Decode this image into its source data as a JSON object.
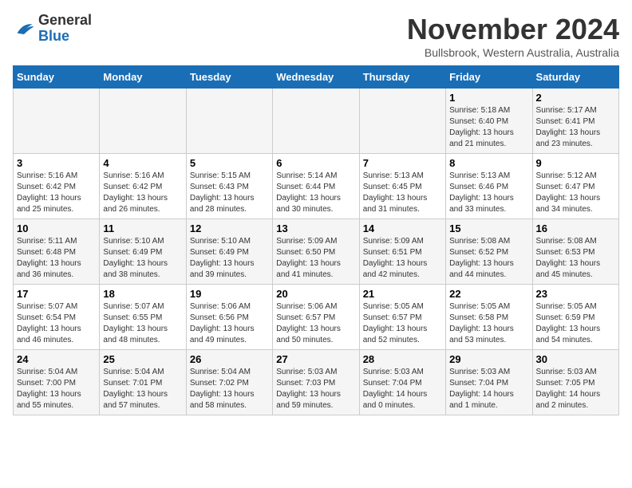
{
  "header": {
    "logo_general": "General",
    "logo_blue": "Blue",
    "month_title": "November 2024",
    "location": "Bullsbrook, Western Australia, Australia"
  },
  "days_of_week": [
    "Sunday",
    "Monday",
    "Tuesday",
    "Wednesday",
    "Thursday",
    "Friday",
    "Saturday"
  ],
  "weeks": [
    [
      {
        "day": "",
        "info": ""
      },
      {
        "day": "",
        "info": ""
      },
      {
        "day": "",
        "info": ""
      },
      {
        "day": "",
        "info": ""
      },
      {
        "day": "",
        "info": ""
      },
      {
        "day": "1",
        "info": "Sunrise: 5:18 AM\nSunset: 6:40 PM\nDaylight: 13 hours and 21 minutes."
      },
      {
        "day": "2",
        "info": "Sunrise: 5:17 AM\nSunset: 6:41 PM\nDaylight: 13 hours and 23 minutes."
      }
    ],
    [
      {
        "day": "3",
        "info": "Sunrise: 5:16 AM\nSunset: 6:42 PM\nDaylight: 13 hours and 25 minutes."
      },
      {
        "day": "4",
        "info": "Sunrise: 5:16 AM\nSunset: 6:42 PM\nDaylight: 13 hours and 26 minutes."
      },
      {
        "day": "5",
        "info": "Sunrise: 5:15 AM\nSunset: 6:43 PM\nDaylight: 13 hours and 28 minutes."
      },
      {
        "day": "6",
        "info": "Sunrise: 5:14 AM\nSunset: 6:44 PM\nDaylight: 13 hours and 30 minutes."
      },
      {
        "day": "7",
        "info": "Sunrise: 5:13 AM\nSunset: 6:45 PM\nDaylight: 13 hours and 31 minutes."
      },
      {
        "day": "8",
        "info": "Sunrise: 5:13 AM\nSunset: 6:46 PM\nDaylight: 13 hours and 33 minutes."
      },
      {
        "day": "9",
        "info": "Sunrise: 5:12 AM\nSunset: 6:47 PM\nDaylight: 13 hours and 34 minutes."
      }
    ],
    [
      {
        "day": "10",
        "info": "Sunrise: 5:11 AM\nSunset: 6:48 PM\nDaylight: 13 hours and 36 minutes."
      },
      {
        "day": "11",
        "info": "Sunrise: 5:10 AM\nSunset: 6:49 PM\nDaylight: 13 hours and 38 minutes."
      },
      {
        "day": "12",
        "info": "Sunrise: 5:10 AM\nSunset: 6:49 PM\nDaylight: 13 hours and 39 minutes."
      },
      {
        "day": "13",
        "info": "Sunrise: 5:09 AM\nSunset: 6:50 PM\nDaylight: 13 hours and 41 minutes."
      },
      {
        "day": "14",
        "info": "Sunrise: 5:09 AM\nSunset: 6:51 PM\nDaylight: 13 hours and 42 minutes."
      },
      {
        "day": "15",
        "info": "Sunrise: 5:08 AM\nSunset: 6:52 PM\nDaylight: 13 hours and 44 minutes."
      },
      {
        "day": "16",
        "info": "Sunrise: 5:08 AM\nSunset: 6:53 PM\nDaylight: 13 hours and 45 minutes."
      }
    ],
    [
      {
        "day": "17",
        "info": "Sunrise: 5:07 AM\nSunset: 6:54 PM\nDaylight: 13 hours and 46 minutes."
      },
      {
        "day": "18",
        "info": "Sunrise: 5:07 AM\nSunset: 6:55 PM\nDaylight: 13 hours and 48 minutes."
      },
      {
        "day": "19",
        "info": "Sunrise: 5:06 AM\nSunset: 6:56 PM\nDaylight: 13 hours and 49 minutes."
      },
      {
        "day": "20",
        "info": "Sunrise: 5:06 AM\nSunset: 6:57 PM\nDaylight: 13 hours and 50 minutes."
      },
      {
        "day": "21",
        "info": "Sunrise: 5:05 AM\nSunset: 6:57 PM\nDaylight: 13 hours and 52 minutes."
      },
      {
        "day": "22",
        "info": "Sunrise: 5:05 AM\nSunset: 6:58 PM\nDaylight: 13 hours and 53 minutes."
      },
      {
        "day": "23",
        "info": "Sunrise: 5:05 AM\nSunset: 6:59 PM\nDaylight: 13 hours and 54 minutes."
      }
    ],
    [
      {
        "day": "24",
        "info": "Sunrise: 5:04 AM\nSunset: 7:00 PM\nDaylight: 13 hours and 55 minutes."
      },
      {
        "day": "25",
        "info": "Sunrise: 5:04 AM\nSunset: 7:01 PM\nDaylight: 13 hours and 57 minutes."
      },
      {
        "day": "26",
        "info": "Sunrise: 5:04 AM\nSunset: 7:02 PM\nDaylight: 13 hours and 58 minutes."
      },
      {
        "day": "27",
        "info": "Sunrise: 5:03 AM\nSunset: 7:03 PM\nDaylight: 13 hours and 59 minutes."
      },
      {
        "day": "28",
        "info": "Sunrise: 5:03 AM\nSunset: 7:04 PM\nDaylight: 14 hours and 0 minutes."
      },
      {
        "day": "29",
        "info": "Sunrise: 5:03 AM\nSunset: 7:04 PM\nDaylight: 14 hours and 1 minute."
      },
      {
        "day": "30",
        "info": "Sunrise: 5:03 AM\nSunset: 7:05 PM\nDaylight: 14 hours and 2 minutes."
      }
    ]
  ]
}
